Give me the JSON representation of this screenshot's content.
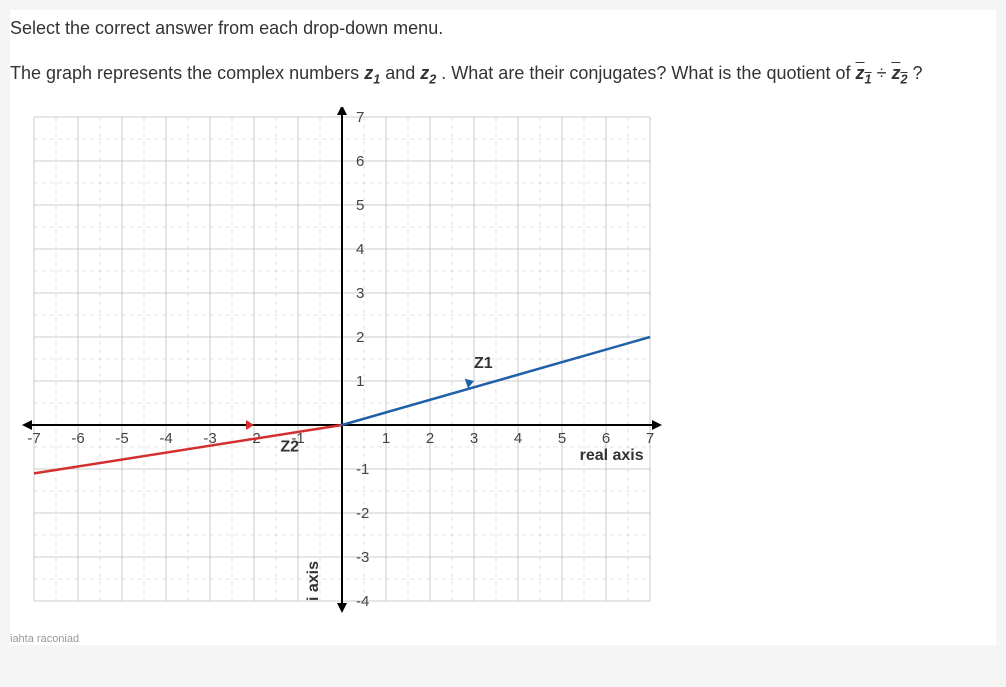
{
  "instruction": "Select the correct answer from each drop-down menu.",
  "problem_prefix": "The graph represents the complex numbers ",
  "z1_label": "z",
  "z1_sub": "1",
  "and_text": " and ",
  "z2_label": "z",
  "z2_sub": "2",
  "problem_mid": ". What are their conjugates? What is the quotient of ",
  "zbar1": "z",
  "zbar1_sub": "1",
  "divide": " ÷ ",
  "zbar2": "z",
  "zbar2_sub": "2",
  "problem_end": "?",
  "footer": "iahta raconiad",
  "chart_data": {
    "type": "scatter",
    "title": "",
    "xlabel": "real axis",
    "ylabel": "i axis",
    "xlim": [
      -7,
      7
    ],
    "ylim": [
      -4,
      7
    ],
    "xticks": [
      -7,
      -6,
      -5,
      -4,
      -3,
      -2,
      -1,
      1,
      2,
      3,
      4,
      5,
      6,
      7
    ],
    "yticks": [
      -4,
      -3,
      -2,
      -1,
      1,
      2,
      3,
      4,
      5,
      6,
      7
    ],
    "series": [
      {
        "name": "Z1",
        "color": "#1e5fa8",
        "point": [
          3,
          1
        ],
        "line_to": [
          7,
          2
        ]
      },
      {
        "name": "Z2",
        "color": "#d32f2f",
        "point": [
          -2,
          0
        ],
        "line_to": [
          -7,
          -1.1
        ]
      }
    ],
    "annotations": [
      {
        "text": "Z1",
        "pos": [
          3,
          1.3
        ]
      },
      {
        "text": "Z2",
        "pos": [
          -1.4,
          -0.6
        ]
      },
      {
        "text": "real axis",
        "pos": [
          5.4,
          -0.8
        ]
      },
      {
        "text": "i axis",
        "pos": [
          -0.55,
          -4
        ],
        "rotate": -90
      }
    ]
  }
}
